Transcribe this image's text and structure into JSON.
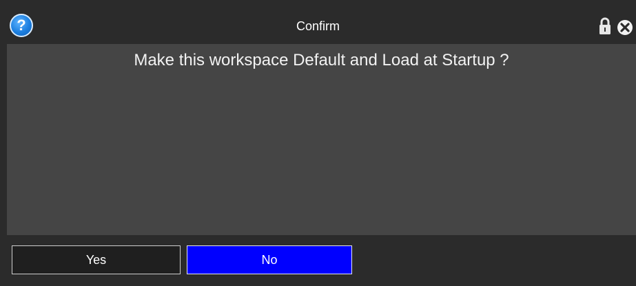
{
  "window": {
    "title": "Confirm",
    "help_icon": "question-mark-icon",
    "help_glyph": "?",
    "lock_icon": "lock-icon",
    "close_icon": "close-icon"
  },
  "content": {
    "message": "Make this workspace Default and Load at Startup ?"
  },
  "buttons": {
    "yes_label": "Yes",
    "no_label": "No"
  },
  "colors": {
    "background": "#2b2b2b",
    "content_panel": "#454545",
    "primary_button": "#0000ff",
    "help_icon": "#1c7fe0"
  }
}
